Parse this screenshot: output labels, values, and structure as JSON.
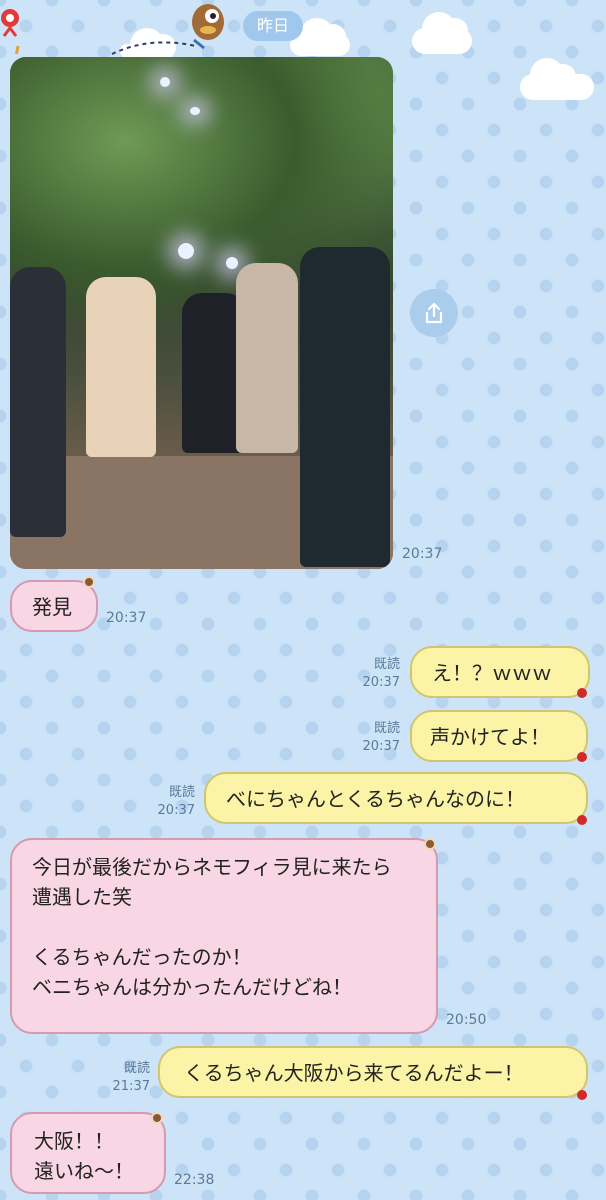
{
  "header": {
    "date_label": "昨日"
  },
  "photo_message": {
    "time": "20:37"
  },
  "messages": [
    {
      "side": "in",
      "text": "発見",
      "time": "20:37"
    },
    {
      "side": "out",
      "text": "え！？ｗｗｗ",
      "read": "既読",
      "time": "20:37"
    },
    {
      "side": "out",
      "text": "声かけてよ！",
      "read": "既読",
      "time": "20:37"
    },
    {
      "side": "out",
      "text": "べにちゃんとくるちゃんなのに！",
      "read": "既読",
      "time": "20:37"
    },
    {
      "side": "in",
      "text": "今日が最後だからネモフィラ見に来たら\n遭遇した笑\n\nくるちゃんだったのか！\nベニちゃんは分かったんだけどね！",
      "time": "20:50"
    },
    {
      "side": "out",
      "text": "くるちゃん大阪から来てるんだよー！",
      "read": "既読",
      "time": "21:37"
    },
    {
      "side": "in",
      "text": "大阪！！\n遠いね～！",
      "time": "22:38"
    }
  ],
  "icons": {
    "share": "share-icon"
  },
  "colors": {
    "incoming_bubble": "#f9d6e3",
    "outgoing_bubble": "#fbf3a6",
    "background": "#cde4f8"
  }
}
